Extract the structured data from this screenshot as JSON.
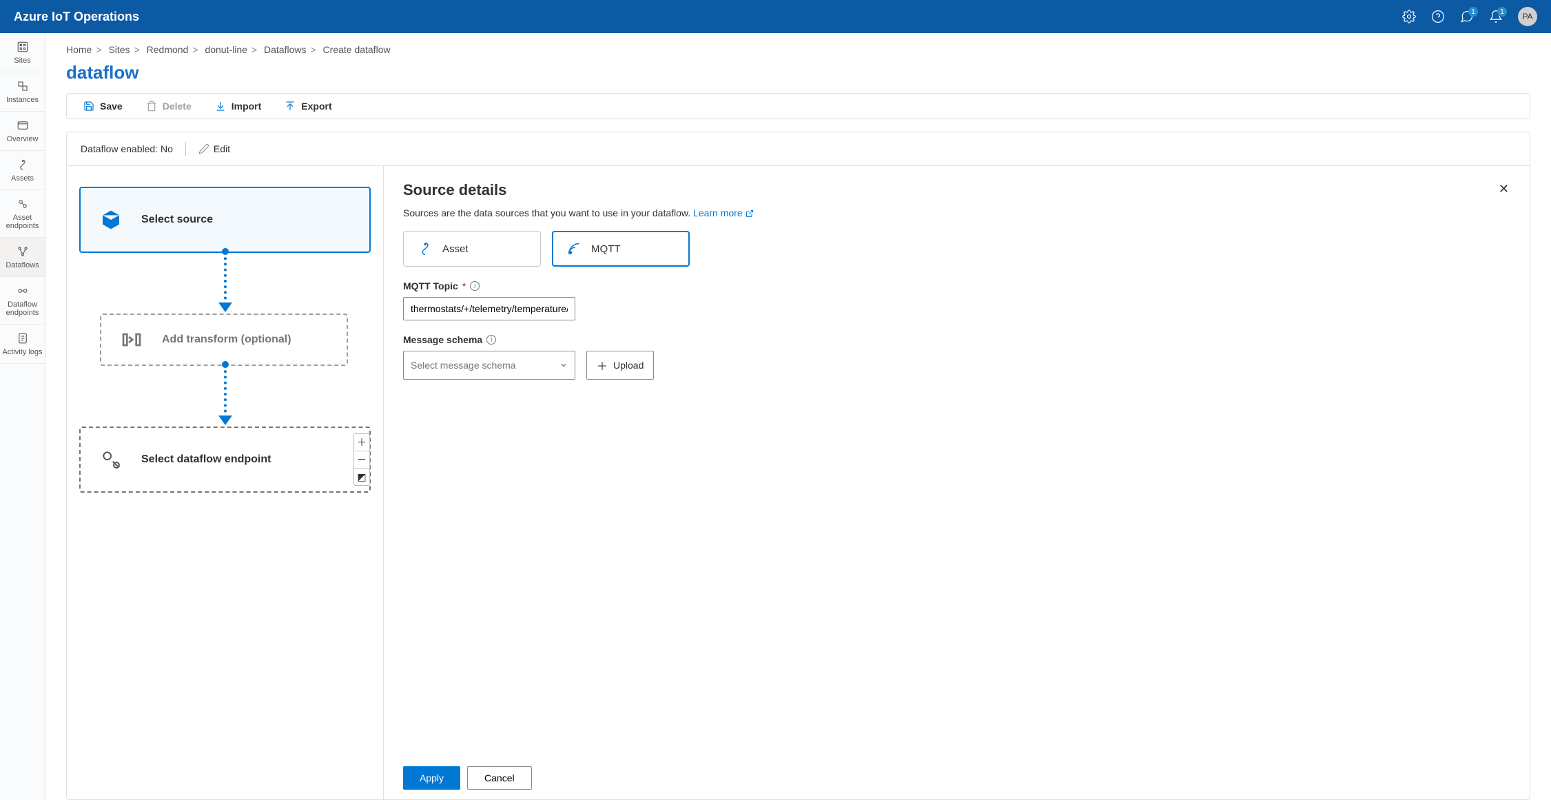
{
  "header": {
    "title": "Azure IoT Operations",
    "notif1_count": "1",
    "notif2_count": "1",
    "avatar": "PA"
  },
  "sidebar": {
    "items": [
      {
        "label": "Sites"
      },
      {
        "label": "Instances"
      },
      {
        "label": "Overview"
      },
      {
        "label": "Assets"
      },
      {
        "label": "Asset endpoints"
      },
      {
        "label": "Dataflows"
      },
      {
        "label": "Dataflow endpoints"
      },
      {
        "label": "Activity logs"
      }
    ]
  },
  "breadcrumb": {
    "items": [
      "Home",
      "Sites",
      "Redmond",
      "donut-line",
      "Dataflows",
      "Create dataflow"
    ]
  },
  "page_title": "dataflow",
  "toolbar": {
    "save": "Save",
    "delete": "Delete",
    "import": "Import",
    "export": "Export"
  },
  "status": {
    "enabled_label": "Dataflow enabled: ",
    "enabled_value": "No",
    "edit": "Edit"
  },
  "flow": {
    "source": "Select source",
    "transform": "Add transform (optional)",
    "destination": "Select dataflow endpoint"
  },
  "panel": {
    "title": "Source details",
    "desc": "Sources are the data sources that you want to use in your dataflow. ",
    "learn_more": "Learn more",
    "tab_asset": "Asset",
    "tab_mqtt": "MQTT",
    "topic_label": "MQTT Topic",
    "topic_value": "thermostats/+/telemetry/temperature/#",
    "schema_label": "Message schema",
    "schema_placeholder": "Select message schema",
    "upload": "Upload",
    "apply": "Apply",
    "cancel": "Cancel"
  }
}
